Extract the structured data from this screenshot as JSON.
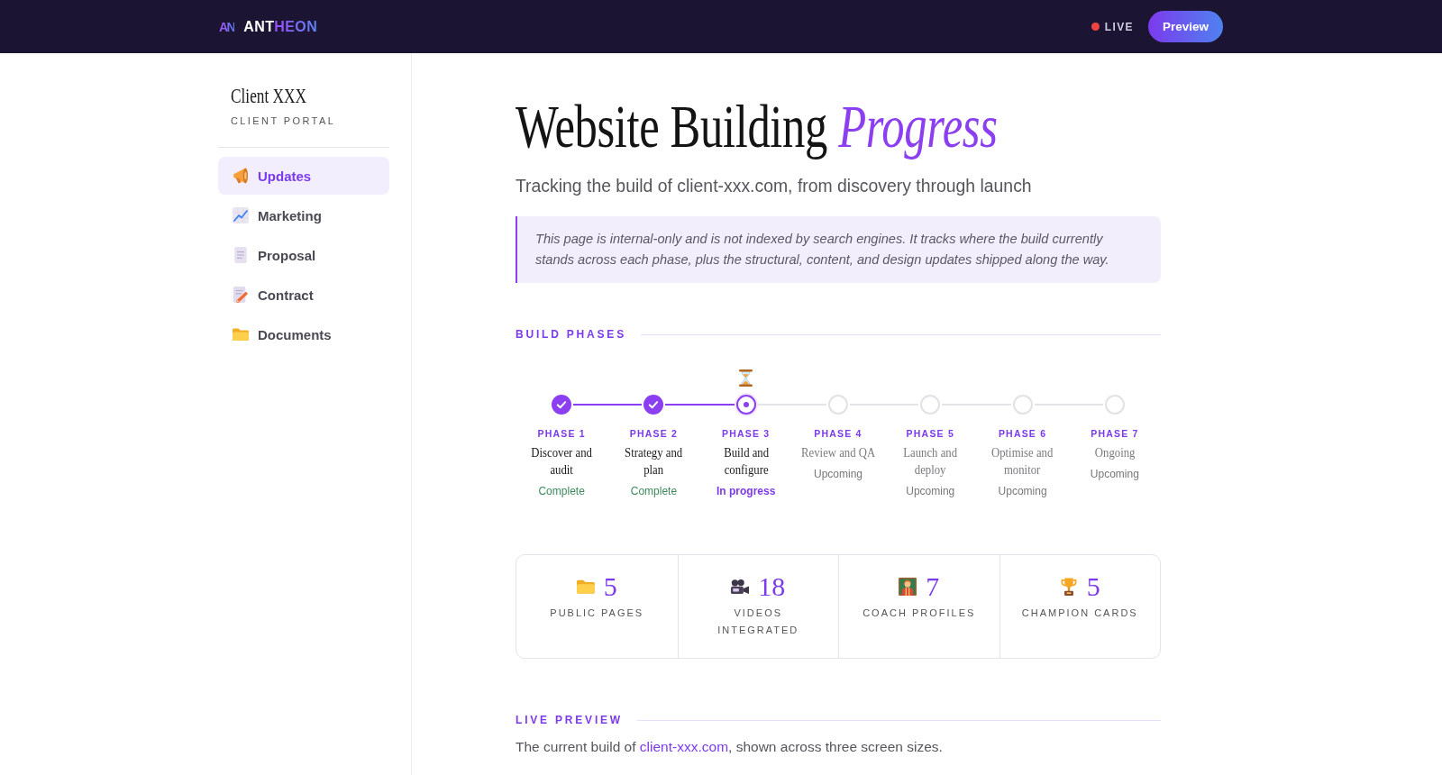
{
  "header": {
    "logo": {
      "mark": "AN",
      "name": "ANT",
      "name_accent": "HEON"
    },
    "live": {
      "label": "LIVE"
    },
    "preview_button": "Preview"
  },
  "sidebar": {
    "title": "Client XXX",
    "subtitle": "CLIENT PORTAL",
    "items": [
      {
        "label": "Updates",
        "selected": true
      },
      {
        "label": "Marketing",
        "selected": false
      },
      {
        "label": "Proposal",
        "selected": false
      },
      {
        "label": "Contract",
        "selected": false
      },
      {
        "label": "Documents",
        "selected": false
      }
    ]
  },
  "page": {
    "title": "Website Building *Progress*",
    "subtitle": "Tracking the build of client-xxx.com, from discovery through launch",
    "notice": "This page is internal-only and is not indexed by search engines. It tracks where the build currently stands across each phase, plus the structural, content, and design updates shipped along the way."
  },
  "build_phases": {
    "heading": "BUILD PHASES",
    "phases": [
      {
        "label": "PHASE 1",
        "name": "Discover and audit",
        "status": "Complete",
        "done": true,
        "current": false
      },
      {
        "label": "PHASE 2",
        "name": "Strategy and plan",
        "status": "Complete",
        "done": true,
        "current": false
      },
      {
        "label": "PHASE 3",
        "name": "Build and configure",
        "status": "In progress",
        "done": false,
        "current": true
      },
      {
        "label": "PHASE 4",
        "name": "Review and QA",
        "status": "Upcoming",
        "done": false,
        "current": false
      },
      {
        "label": "PHASE 5",
        "name": "Launch and deploy",
        "status": "Upcoming",
        "done": false,
        "current": false
      },
      {
        "label": "PHASE 6",
        "name": "Optimise and monitor",
        "status": "Upcoming",
        "done": false,
        "current": false
      },
      {
        "label": "PHASE 7",
        "name": "Ongoing",
        "status": "Upcoming",
        "done": false,
        "current": false
      }
    ]
  },
  "stats": [
    {
      "value": "5",
      "label": "PUBLIC PAGES"
    },
    {
      "value": "18",
      "label": "VIDEOS INTEGRATED"
    },
    {
      "value": "7",
      "label": "COACH PROFILES"
    },
    {
      "value": "5",
      "label": "CHAMPION CARDS"
    }
  ],
  "live_preview": {
    "heading": "LIVE PREVIEW",
    "text_before": "The current build of ",
    "link": "client-xxx.com",
    "text_after": ", shown across three screen sizes."
  }
}
